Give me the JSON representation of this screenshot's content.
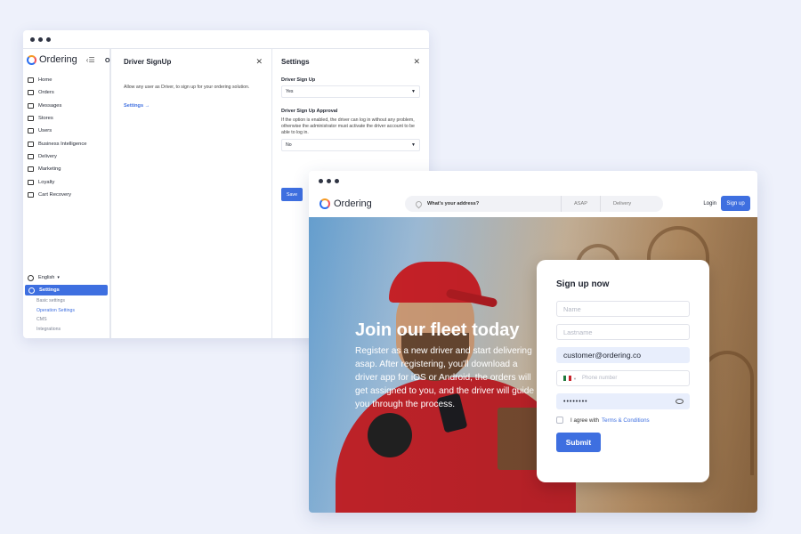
{
  "admin": {
    "logo": "Ordering",
    "menu": [
      {
        "label": "Home",
        "icon": "home-icon"
      },
      {
        "label": "Orders",
        "icon": "list-icon"
      },
      {
        "label": "Messages",
        "icon": "chat-icon"
      },
      {
        "label": "Stores",
        "icon": "store-icon"
      },
      {
        "label": "Users",
        "icon": "users-icon"
      },
      {
        "label": "Business Intelligence",
        "icon": "chart-icon"
      },
      {
        "label": "Delivery",
        "icon": "truck-icon"
      },
      {
        "label": "Marketing",
        "icon": "trend-icon"
      },
      {
        "label": "Loyalty",
        "icon": "loyalty-icon"
      },
      {
        "label": "Cart Recovery",
        "icon": "cart-icon"
      }
    ],
    "language": "English",
    "settings_label": "Settings",
    "submenu": [
      "Basic settings",
      "Operation Settings",
      "CMS",
      "Integrations"
    ],
    "column_letter": "O",
    "panel_driver": {
      "title": "Driver SignUp",
      "description": "Allow any user as Driver, to sign up for your ordering solution.",
      "link": "Settings →"
    },
    "panel_settings": {
      "title": "Settings",
      "field1_label": "Driver Sign Up",
      "field1_value": "Yes",
      "field2_label": "Driver Sign Up Approval",
      "field2_help": "If the option is enabled, the driver can log in without any problem, otherwise the administrator must activate the driver account to be able to log in.",
      "field2_value": "No",
      "save_label": "Save"
    }
  },
  "site": {
    "logo": "Ordering",
    "address_placeholder": "What's your address?",
    "time_option": "ASAP",
    "mode_option": "Delivery",
    "login_label": "Login",
    "signup_label": "Sign up",
    "hero_title": "Join our fleet today",
    "hero_text": "Register as a new driver and start delivering asap. After registering, you'll download a driver app for iOS or Android, the orders will get assigned to you, and the driver will guide you through the process.",
    "form": {
      "title": "Sign up now",
      "name_placeholder": "Name",
      "lastname_placeholder": "Lastname",
      "email_value": "customer@ordering.co",
      "phone_placeholder": "Phone number",
      "password_mask": "••••••••",
      "agree_text": "I agree with",
      "terms_link": "Terms & Conditions",
      "submit_label": "Submit"
    }
  },
  "colors": {
    "accent": "#3e6fe0",
    "background": "#eef1fb"
  }
}
